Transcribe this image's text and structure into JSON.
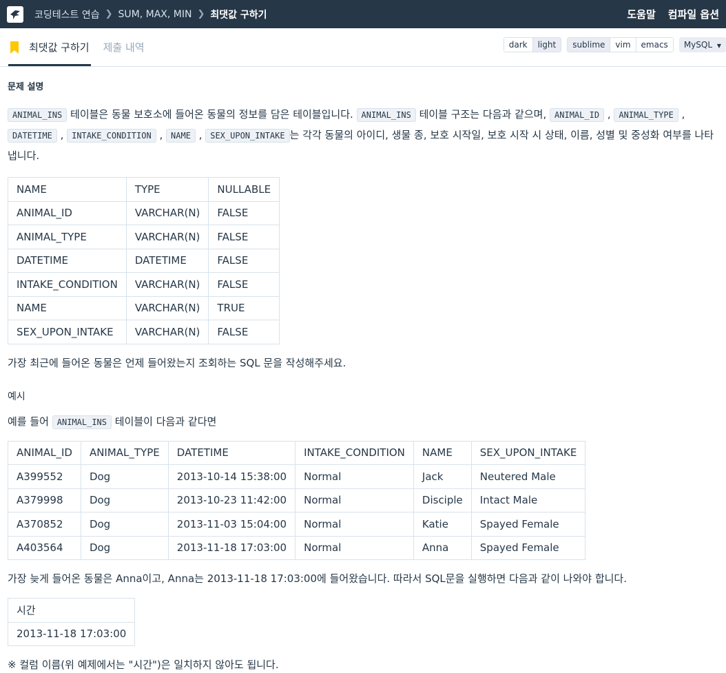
{
  "header": {
    "breadcrumbs": [
      "코딩테스트 연습",
      "SUM, MAX, MIN",
      "최댓값 구하기"
    ],
    "help": "도움말",
    "compile_options": "컴파일 옵션"
  },
  "tabs": {
    "problem": "최댓값 구하기",
    "submissions": "제출 내역"
  },
  "tools": {
    "themes": [
      "dark",
      "light"
    ],
    "keymaps": [
      "sublime",
      "vim",
      "emacs"
    ],
    "language": "MySQL"
  },
  "problem": {
    "section_title": "문제 설명",
    "intro_code1": "ANIMAL_INS",
    "intro_text1": " 테이블은 동물 보호소에 들어온 동물의 정보를 담은 테이블입니다. ",
    "intro_code2": "ANIMAL_INS",
    "intro_text2": " 테이블 구조는 다음과 같으며, ",
    "cols": [
      "ANIMAL_ID",
      "ANIMAL_TYPE",
      "DATETIME",
      "INTAKE_CONDITION",
      "NAME",
      "SEX_UPON_INTAKE"
    ],
    "intro_text3": "는 각각 동물의 아이디, 생물 종, 보호 시작일, 보호 시작 시 상태, 이름, 성별 및 중성화 여부를 나타냅니다.",
    "schema_headers": [
      "NAME",
      "TYPE",
      "NULLABLE"
    ],
    "schema_rows": [
      [
        "ANIMAL_ID",
        "VARCHAR(N)",
        "FALSE"
      ],
      [
        "ANIMAL_TYPE",
        "VARCHAR(N)",
        "FALSE"
      ],
      [
        "DATETIME",
        "DATETIME",
        "FALSE"
      ],
      [
        "INTAKE_CONDITION",
        "VARCHAR(N)",
        "FALSE"
      ],
      [
        "NAME",
        "VARCHAR(N)",
        "TRUE"
      ],
      [
        "SEX_UPON_INTAKE",
        "VARCHAR(N)",
        "FALSE"
      ]
    ],
    "task": "가장 최근에 들어온 동물은 언제 들어왔는지 조회하는 SQL 문을 작성해주세요.",
    "example_label": "예시",
    "example_intro_pre": "예를 들어 ",
    "example_intro_code": "ANIMAL_INS",
    "example_intro_post": " 테이블이 다음과 같다면",
    "example_headers": [
      "ANIMAL_ID",
      "ANIMAL_TYPE",
      "DATETIME",
      "INTAKE_CONDITION",
      "NAME",
      "SEX_UPON_INTAKE"
    ],
    "example_rows": [
      [
        "A399552",
        "Dog",
        "2013-10-14 15:38:00",
        "Normal",
        "Jack",
        "Neutered Male"
      ],
      [
        "A379998",
        "Dog",
        "2013-10-23 11:42:00",
        "Normal",
        "Disciple",
        "Intact Male"
      ],
      [
        "A370852",
        "Dog",
        "2013-11-03 15:04:00",
        "Normal",
        "Katie",
        "Spayed Female"
      ],
      [
        "A403564",
        "Dog",
        "2013-11-18 17:03:00",
        "Normal",
        "Anna",
        "Spayed Female"
      ]
    ],
    "result_text": "가장 늦게 들어온 동물은 Anna이고, Anna는 2013-11-18 17:03:00에 들어왔습니다. 따라서 SQL문을 실행하면 다음과 같이 나와야 합니다.",
    "result_header": "시간",
    "result_value": "2013-11-18 17:03:00",
    "note": "※ 컬럼 이름(위 예제에서는 \"시간\")은 일치하지 않아도 됩니다."
  }
}
